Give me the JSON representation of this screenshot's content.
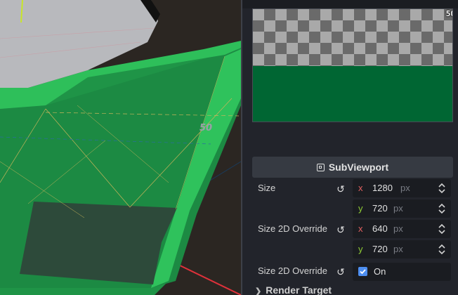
{
  "viewport": {
    "overlay_number": "50",
    "colors": {
      "mesh_green": "#2ebf5a",
      "mesh_dark": "#177a3a",
      "ground": "#2b2622",
      "grey_top": "#b8b9bd"
    }
  },
  "inspector": {
    "preview": {
      "label": "50",
      "top_fill": "checkerboard",
      "bottom_color": "#006633"
    },
    "header": {
      "icon": "subviewport-icon",
      "title": "SubViewport"
    },
    "size": {
      "label": "Size",
      "x": {
        "axis": "x",
        "value": "1280",
        "unit": "px"
      },
      "y": {
        "axis": "y",
        "value": "720",
        "unit": "px"
      }
    },
    "size_2d_override": {
      "label": "Size 2D Override",
      "x": {
        "axis": "x",
        "value": "640",
        "unit": "px"
      },
      "y": {
        "axis": "y",
        "value": "720",
        "unit": "px"
      }
    },
    "size_2d_override_stretch": {
      "label": "Size 2D Override",
      "checked": true,
      "state_text": "On"
    },
    "section": {
      "title": "Render Target",
      "chevron": "chevron-right-icon"
    },
    "colors": {
      "panel": "#22242b",
      "field": "#1a1c21",
      "axis_x": "#e0605f",
      "axis_y": "#8ecb35",
      "accent": "#4d8ef0"
    }
  }
}
